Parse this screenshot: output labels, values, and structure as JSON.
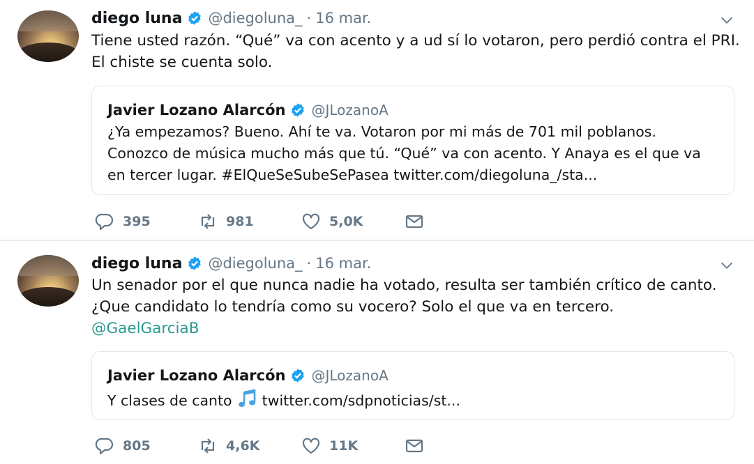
{
  "tweets": [
    {
      "author": {
        "name": "diego luna",
        "handle": "@diegoluna_"
      },
      "separator": "·",
      "date": "16 mar.",
      "text": "Tiene usted razón. “Qué” va con acento y a ud sí lo votaron, pero perdió contra el PRI. El chiste se cuenta solo.",
      "quoted": {
        "name": "Javier Lozano Alarcón",
        "handle": "@JLozanoA",
        "text": "¿Ya empezamos? Bueno. Ahí te va. Votaron por mi más de 701 mil poblanos. Conozco de música mucho más que tú. “Qué” va con acento. Y Anaya es el que va en tercer lugar. #ElQueSeSubeSePasea twitter.com/diegoluna_/sta..."
      },
      "stats": {
        "replies": "395",
        "retweets": "981",
        "likes": "5,0K"
      }
    },
    {
      "author": {
        "name": "diego luna",
        "handle": "@diegoluna_"
      },
      "separator": "·",
      "date": "16 mar.",
      "text": "Un senador por el que nunca nadie ha votado, resulta ser también crítico de canto. ¿Que candidato lo tendría como su vocero? Solo el que va en tercero.",
      "mention": "@GaelGarciaB",
      "quoted": {
        "name": "Javier Lozano Alarcón",
        "handle": "@JLozanoA",
        "text_before": "Y clases de canto",
        "text_after": "twitter.com/sdpnoticias/st..."
      },
      "stats": {
        "replies": "805",
        "retweets": "4,6K",
        "likes": "11K"
      }
    }
  ],
  "icons": {
    "verified": "verified-badge-icon",
    "menu": "chevron-down-icon",
    "reply": "reply-icon",
    "retweet": "retweet-icon",
    "like": "heart-icon",
    "dm": "envelope-icon",
    "music": "music-note-icon"
  },
  "colors": {
    "verified": "#1da1f2",
    "muted": "#657786",
    "mention": "#2b9a8c",
    "border": "#e1e8ed"
  }
}
